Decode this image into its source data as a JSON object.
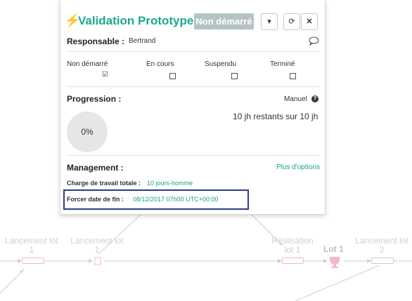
{
  "panel": {
    "title": "Validation Prototype",
    "status_label": "Non démarré",
    "dropdown_icon": "caret-down-icon",
    "refresh_icon": "refresh-icon",
    "close_icon": "close-icon",
    "responsable_label": "Responsable :",
    "responsable_value": "Bertrand",
    "statuses": [
      {
        "label": "Non démarré",
        "checked": true
      },
      {
        "label": "En cours",
        "checked": false
      },
      {
        "label": "Suspendu",
        "checked": false
      },
      {
        "label": "Terminé",
        "checked": false
      }
    ],
    "progression_label": "Progression :",
    "mode_label": "Manuel",
    "progress_percent": "0%",
    "remaining_text": "10 jh restants sur 10 jh",
    "management_label": "Management :",
    "more_options": "Plus d'options",
    "workload_label": "Charge de travail totale :",
    "workload_value": "10 jours-homme",
    "force_label": "Forcer date de fin :",
    "force_value": "08/12/2017 07h00 UTC+00:00"
  },
  "diagram": {
    "nodes": [
      {
        "label1": "Lancement lot",
        "label2": "1"
      },
      {
        "label1": "Lancement lot",
        "label2": "1"
      },
      {
        "label1": "Réalisation",
        "label2": "lot 1"
      },
      {
        "label1": "Lot 1",
        "label2": ""
      },
      {
        "label1": "Lancement lot",
        "label2": "2"
      }
    ]
  }
}
